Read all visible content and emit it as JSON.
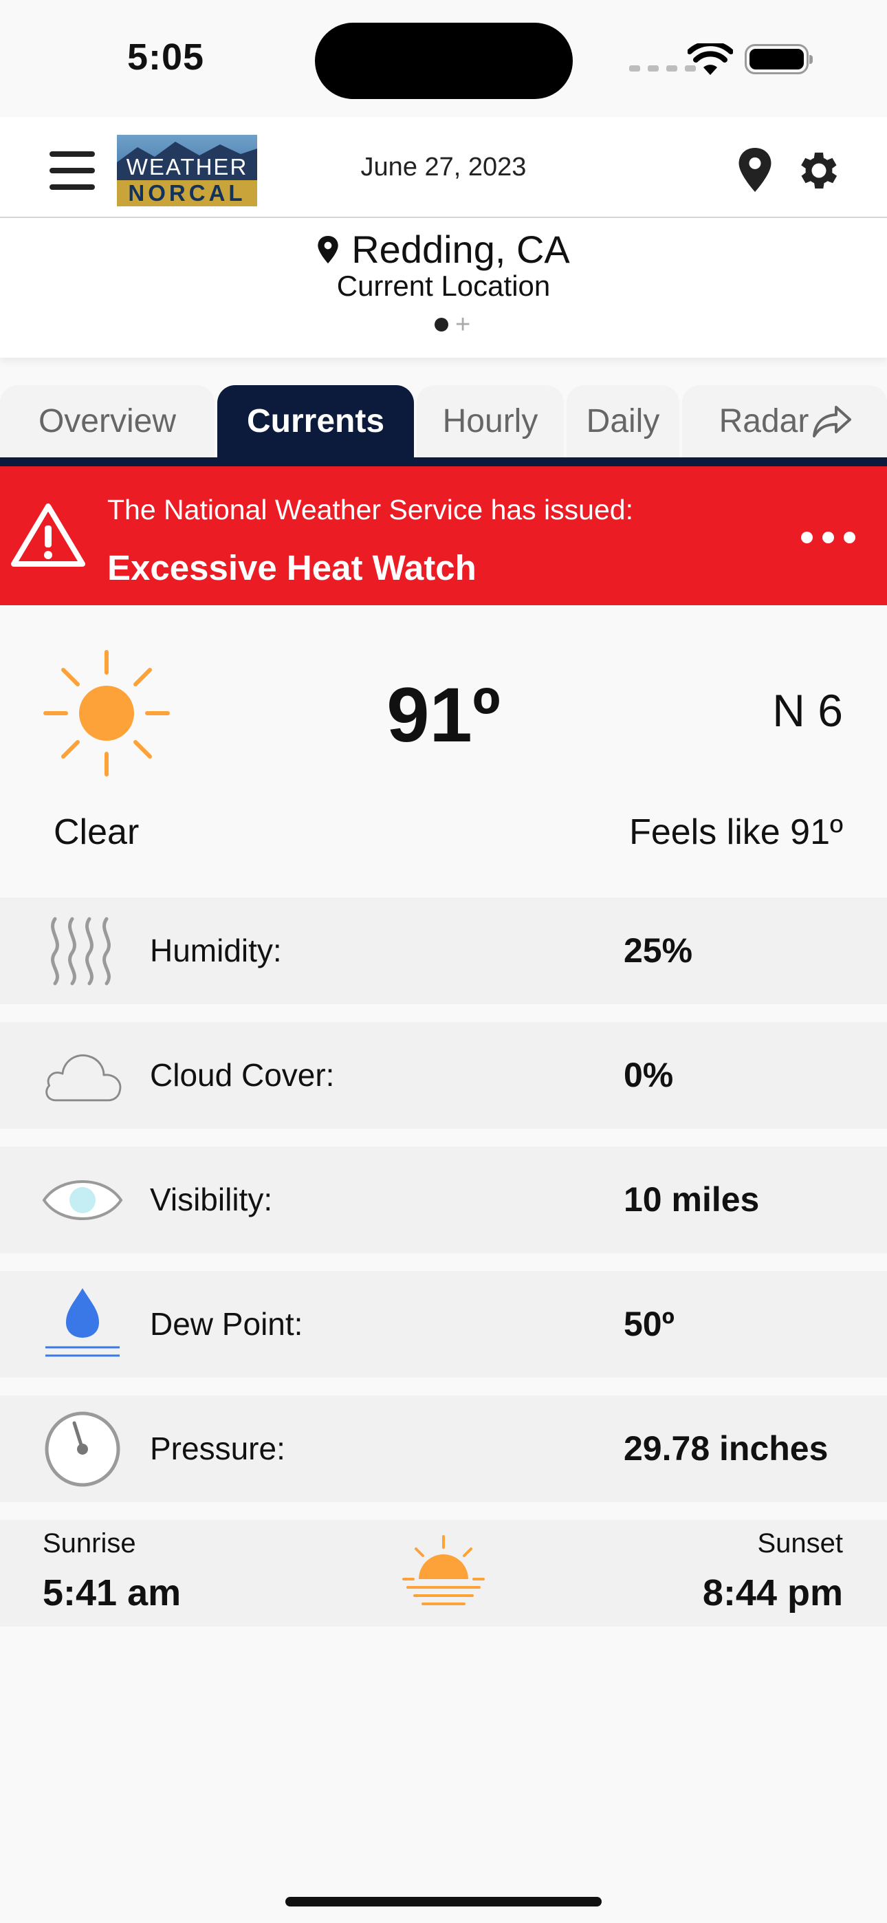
{
  "status": {
    "time": "5:05"
  },
  "header": {
    "logo_top": "WEATHER",
    "logo_bottom": "NORCAL",
    "date": "June 27, 2023"
  },
  "location": {
    "name": "Redding, CA",
    "subtitle": "Current Location"
  },
  "tabs": [
    {
      "label": "Overview"
    },
    {
      "label": "Currents",
      "active": true
    },
    {
      "label": "Hourly"
    },
    {
      "label": "Daily"
    },
    {
      "label": "Radar"
    }
  ],
  "alert": {
    "line1": "The National Weather Service has issued:",
    "line2": "Excessive Heat Watch",
    "color": "#ec1c24"
  },
  "current": {
    "temperature": "91º",
    "wind": "N 6",
    "condition": "Clear",
    "feels_like": "Feels like 91º",
    "icon": "sun-icon"
  },
  "details": [
    {
      "icon": "humidity-icon",
      "label": "Humidity:",
      "value": "25%"
    },
    {
      "icon": "cloud-icon",
      "label": "Cloud Cover:",
      "value": "0%"
    },
    {
      "icon": "eye-icon",
      "label": "Visibility:",
      "value": "10 miles"
    },
    {
      "icon": "dew-drop-icon",
      "label": "Dew Point:",
      "value": "50º"
    },
    {
      "icon": "pressure-gauge-icon",
      "label": "Pressure:",
      "value": "29.78 inches"
    }
  ],
  "sun": {
    "sunrise_label": "Sunrise",
    "sunrise_value": "5:41 am",
    "sunset_label": "Sunset",
    "sunset_value": "8:44 pm"
  },
  "colors": {
    "navy": "#0c1b3c",
    "sun": "#fca239",
    "drop": "#3b78e7"
  }
}
